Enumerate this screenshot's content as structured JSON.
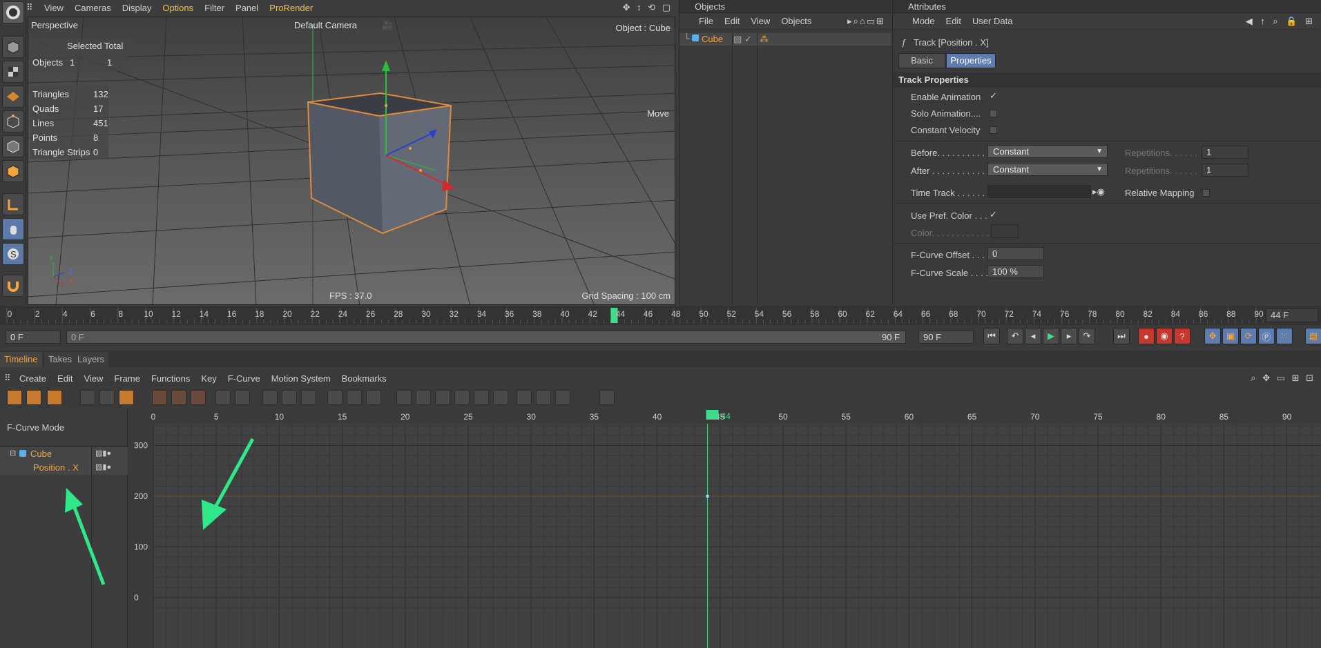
{
  "viewport": {
    "menu": [
      "View",
      "Cameras",
      "Display",
      "Options",
      "Filter",
      "Panel",
      "ProRender"
    ],
    "view_name": "Perspective",
    "camera": "Default Camera",
    "object_label": "Object : Cube",
    "move_label": "Move",
    "fps": "FPS : 37.0",
    "grid_spacing": "Grid Spacing : 100 cm",
    "stats_header": "Selected Total",
    "stats_objects": {
      "label": "Objects",
      "selected": "1",
      "total": "1"
    },
    "stats": [
      {
        "label": "Triangles",
        "value": "132"
      },
      {
        "label": "Quads",
        "value": "17"
      },
      {
        "label": "Lines",
        "value": "451"
      },
      {
        "label": "Points",
        "value": "8"
      },
      {
        "label": "Triangle Strips",
        "value": "0"
      }
    ],
    "axis_y": "Y",
    "axis_z": "Z",
    "axis_x": "X"
  },
  "objects": {
    "title": "Objects",
    "menu": [
      "File",
      "Edit",
      "View",
      "Objects"
    ],
    "items": [
      {
        "name": "Cube"
      }
    ]
  },
  "attributes": {
    "title": "Attributes",
    "menu": [
      "Mode",
      "Edit",
      "User Data"
    ],
    "track_title": "Track [Position . X]",
    "tabs": [
      "Basic",
      "Properties"
    ],
    "section": "Track Properties",
    "enable_animation": "Enable Animation",
    "solo_animation": "Solo Animation....",
    "constant_velocity": "Constant Velocity",
    "before_label": "Before. . . . . . . . . . . .",
    "before_value": "Constant",
    "after_label": "After . . . . . . . . . . . . .",
    "after_value": "Constant",
    "repetitions_label": "Repetitions. . . . . .",
    "repetitions_value": "1",
    "time_track": "Time Track . . . . . . .",
    "relative_mapping": "Relative Mapping",
    "use_pref_color": "Use Pref. Color . . .",
    "color_label": "Color. . . . . . . . . . . .",
    "fcurve_offset": "F-Curve Offset . . .",
    "fcurve_offset_value": "0",
    "fcurve_scale": "F-Curve Scale . . . .",
    "fcurve_scale_value": "100 %"
  },
  "ruler": {
    "ticks": [
      "0",
      "2",
      "4",
      "6",
      "8",
      "10",
      "12",
      "14",
      "16",
      "18",
      "20",
      "22",
      "24",
      "26",
      "28",
      "30",
      "32",
      "34",
      "36",
      "38",
      "40",
      "42",
      "44",
      "46",
      "48",
      "50",
      "52",
      "54",
      "56",
      "58",
      "60",
      "62",
      "64",
      "66",
      "68",
      "70",
      "72",
      "74",
      "76",
      "78",
      "80",
      "82",
      "84",
      "86",
      "88",
      "90"
    ],
    "current": "44",
    "current_frame": "44 F"
  },
  "transport": {
    "start": "0 F",
    "range_start": "0 F",
    "range_end": "90 F",
    "end": "90 F"
  },
  "timeline": {
    "tabs": [
      "Timeline",
      "Takes",
      "Layers"
    ],
    "menu": [
      "Create",
      "Edit",
      "View",
      "Frame",
      "Functions",
      "Key",
      "F-Curve",
      "Motion System",
      "Bookmarks"
    ],
    "mode": "F-Curve Mode",
    "tree": [
      {
        "name": "Cube"
      },
      {
        "name": "Position . X"
      }
    ],
    "x_ticks": [
      "0",
      "5",
      "10",
      "15",
      "20",
      "25",
      "30",
      "35",
      "40",
      "45",
      "50",
      "55",
      "60",
      "65",
      "70",
      "75",
      "80",
      "85",
      "90"
    ],
    "y_ticks": [
      "300",
      "200",
      "100",
      "0"
    ],
    "current": "44"
  },
  "colors": {
    "accent_orange": "#f2a53c",
    "playhead_green": "#3fdc8a",
    "tab_blue": "#5d7cb0",
    "arrow_green": "#2ee88a"
  },
  "icons": [
    "search-icon",
    "arrow-icon",
    "home-icon",
    "close-icon",
    "play-icon",
    "record-icon",
    "lock-icon"
  ]
}
